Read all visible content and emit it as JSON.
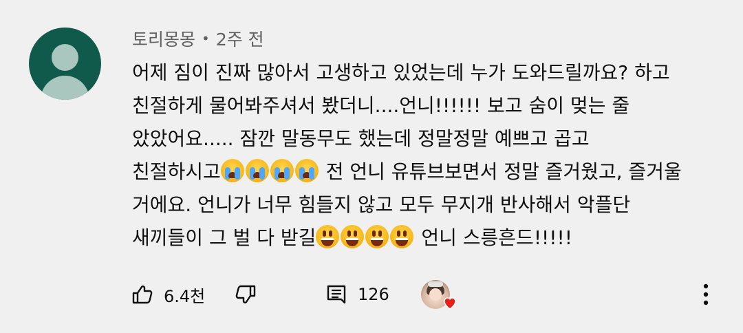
{
  "comment": {
    "author": "토리몽몽",
    "separator": "•",
    "time": "2주 전",
    "lines": [
      "어제 짐이 진짜 많아서 고생하고 있었는데 누가 도와드릴까요? 하고",
      "친절하게 물어봐주셔서 봤더니....언니!!!!!! 보고 숨이 멎는 줄",
      "았았어요..... 잠깐 말동무도 했는데 정말정말 예쁘고 곱고"
    ],
    "line4_prefix": "친절하시고",
    "line4_suffix": " 전 언니 유튜브보면서 정말 즐거웠고, 즐거울",
    "line5": "거에요. 언니가 너무 힘들지 않고 모두 무지개 반사해서 악플단",
    "line6_prefix": "새끼들이 그 벌 다 받길",
    "line6_suffix": " 언니 스릉흔드!!!!!",
    "emoji_line4": "crying-face-emoji",
    "emoji_line6": "grinning-face-emoji"
  },
  "actions": {
    "likes": "6.4천",
    "replies": "126"
  },
  "colors": {
    "background": "#f0f0f0",
    "avatar_bg": "#0f5a4a",
    "avatar_fg": "#a9c7bf",
    "meta_text": "#606060",
    "heart": "#e62117"
  }
}
